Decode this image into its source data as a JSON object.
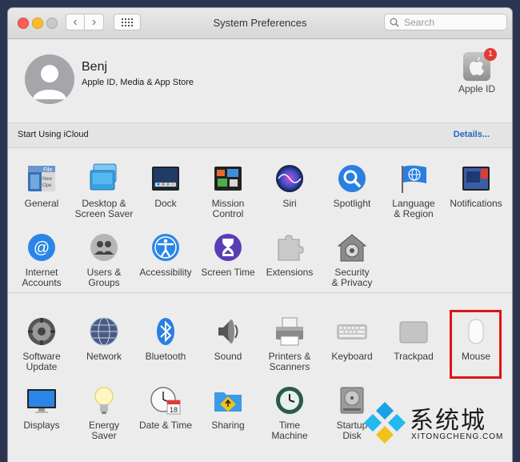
{
  "window": {
    "title": "System Preferences"
  },
  "search": {
    "placeholder": "Search"
  },
  "account": {
    "name": "Benj",
    "subtitle": "Apple ID, Media & App Store",
    "apple_id_label": "Apple ID",
    "badge_count": "1"
  },
  "icloud": {
    "text": "Start Using iCloud",
    "details": "Details..."
  },
  "row1": [
    {
      "l1": "General",
      "l2": "",
      "icon": "general-icon"
    },
    {
      "l1": "Desktop &",
      "l2": "Screen Saver",
      "icon": "desktop-icon"
    },
    {
      "l1": "Dock",
      "l2": "",
      "icon": "dock-icon"
    },
    {
      "l1": "Mission",
      "l2": "Control",
      "icon": "mission-control-icon"
    },
    {
      "l1": "Siri",
      "l2": "",
      "icon": "siri-icon"
    },
    {
      "l1": "Spotlight",
      "l2": "",
      "icon": "spotlight-icon"
    },
    {
      "l1": "Language",
      "l2": "& Region",
      "icon": "language-icon"
    },
    {
      "l1": "Notifications",
      "l2": "",
      "icon": "notifications-icon"
    }
  ],
  "row2": [
    {
      "l1": "Internet",
      "l2": "Accounts",
      "icon": "internet-accounts-icon"
    },
    {
      "l1": "Users &",
      "l2": "Groups",
      "icon": "users-icon"
    },
    {
      "l1": "Accessibility",
      "l2": "",
      "icon": "accessibility-icon"
    },
    {
      "l1": "Screen Time",
      "l2": "",
      "icon": "screen-time-icon"
    },
    {
      "l1": "Extensions",
      "l2": "",
      "icon": "extensions-icon"
    },
    {
      "l1": "Security",
      "l2": "& Privacy",
      "icon": "security-icon"
    }
  ],
  "row3": [
    {
      "l1": "Software",
      "l2": "Update",
      "icon": "software-update-icon"
    },
    {
      "l1": "Network",
      "l2": "",
      "icon": "network-icon"
    },
    {
      "l1": "Bluetooth",
      "l2": "",
      "icon": "bluetooth-icon"
    },
    {
      "l1": "Sound",
      "l2": "",
      "icon": "sound-icon"
    },
    {
      "l1": "Printers &",
      "l2": "Scanners",
      "icon": "printers-icon"
    },
    {
      "l1": "Keyboard",
      "l2": "",
      "icon": "keyboard-icon"
    },
    {
      "l1": "Trackpad",
      "l2": "",
      "icon": "trackpad-icon"
    },
    {
      "l1": "Mouse",
      "l2": "",
      "icon": "mouse-icon"
    }
  ],
  "row4": [
    {
      "l1": "Displays",
      "l2": "",
      "icon": "displays-icon"
    },
    {
      "l1": "Energy",
      "l2": "Saver",
      "icon": "energy-saver-icon"
    },
    {
      "l1": "Date & Time",
      "l2": "",
      "icon": "date-time-icon"
    },
    {
      "l1": "Sharing",
      "l2": "",
      "icon": "sharing-icon"
    },
    {
      "l1": "Time",
      "l2": "Machine",
      "icon": "time-machine-icon"
    },
    {
      "l1": "Startup",
      "l2": "Disk",
      "icon": "startup-disk-icon"
    }
  ],
  "calendar_day": "18",
  "watermark": {
    "text": "系统城",
    "url": "XITONGCHENG.COM"
  },
  "colors": {
    "link": "#2566c9",
    "highlight": "#e01414",
    "badge": "#e23b36"
  }
}
